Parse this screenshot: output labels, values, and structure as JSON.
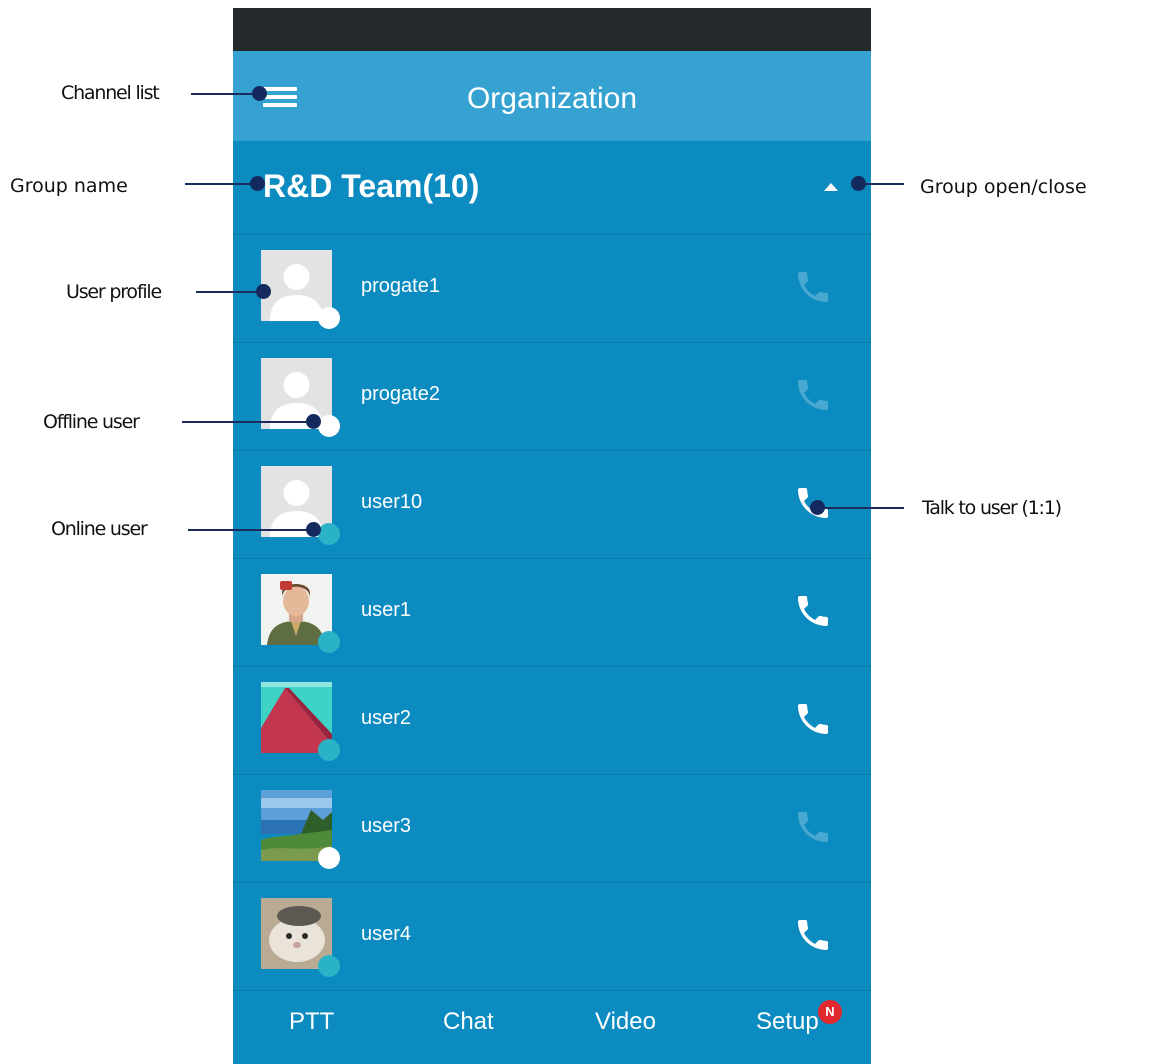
{
  "header": {
    "title": "Organization"
  },
  "group": {
    "name": "R&D Team(10)",
    "expanded": true
  },
  "users": [
    {
      "name": "progate1",
      "status": "offline",
      "call_enabled": false,
      "avatar": "placeholder"
    },
    {
      "name": "progate2",
      "status": "offline",
      "call_enabled": false,
      "avatar": "placeholder"
    },
    {
      "name": "user10",
      "status": "online",
      "call_enabled": true,
      "avatar": "placeholder"
    },
    {
      "name": "user1",
      "status": "online",
      "call_enabled": true,
      "avatar": "photo-person"
    },
    {
      "name": "user2",
      "status": "online",
      "call_enabled": true,
      "avatar": "photo-red-roof"
    },
    {
      "name": "user3",
      "status": "offline",
      "call_enabled": false,
      "avatar": "photo-landscape"
    },
    {
      "name": "user4",
      "status": "online",
      "call_enabled": true,
      "avatar": "photo-pet"
    }
  ],
  "nav": {
    "tabs": [
      "PTT",
      "Chat",
      "Video",
      "Setup"
    ],
    "setup_badge": "N"
  },
  "annotations": {
    "channel_list": "Channel list",
    "group_name": "Group name",
    "group_open_close": "Group open/close",
    "user_profile": "User profile",
    "offline_user": "Offline user",
    "online_user": "Online user",
    "talk_to_user": "Talk to user (1:1)"
  },
  "colors": {
    "app_bg": "#0b8bbf",
    "topbar": "#35a2d1",
    "statusbar": "#26292c",
    "online": "#2ab3c7",
    "offline": "#ffffff",
    "badge": "#e0282e",
    "callout_line": "#142a5e"
  }
}
